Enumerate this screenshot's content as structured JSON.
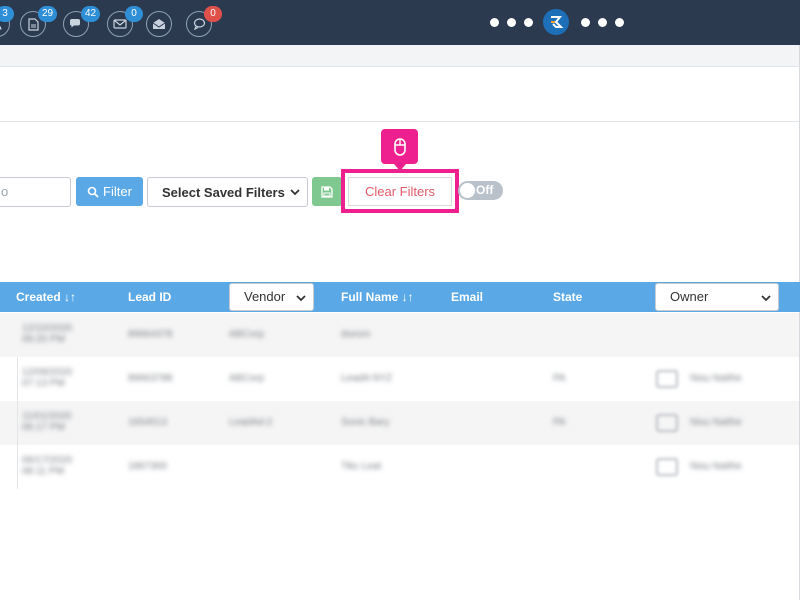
{
  "navbar": {
    "badges": [
      "3",
      "29",
      "42",
      "0",
      "0"
    ],
    "icons": [
      "user-icon",
      "document-icon",
      "comments-icon",
      "envelope-icon",
      "envelope-open-icon",
      "chat-icon"
    ],
    "colors": {
      "background": "#2b3a4f",
      "badge": "#2f8fd6",
      "badge_alert": "#e0504a"
    }
  },
  "filters": {
    "search_placeholder": "o",
    "filter_button": "Filter",
    "saved_filters": "Select Saved Filters",
    "clear_button": "Clear Filters",
    "toggle_label": "Off",
    "highlight_color": "#ee1f8e"
  },
  "table": {
    "columns": {
      "created": "Created ↓↑",
      "lead_id": "Lead ID",
      "vendor": "Vendor",
      "full_name": "Full Name ↓↑",
      "email": "Email",
      "state": "State",
      "owner": "Owner"
    },
    "header_color": "#5aa8e6",
    "rows": [
      {
        "created": "12/10/2020 09:20 PM",
        "lead_id": "89664378",
        "vendor": "ABCorp",
        "full_name": "dsesm",
        "state": "",
        "owner": ""
      },
      {
        "created": "12/09/2020 07:13 PM",
        "lead_id": "89663788",
        "vendor": "ABCorp",
        "full_name": "LeadA NYZ",
        "state": "PA",
        "owner": "Nisu Naithe"
      },
      {
        "created": "11/01/2020 06:17 PM",
        "lead_id": "1654513",
        "vendor": "LeadAd-2",
        "full_name": "Sonic Bary",
        "state": "PA",
        "owner": "Nisu Naithe"
      },
      {
        "created": "06/17/2020 08:11 PM",
        "lead_id": "1867300",
        "vendor": "",
        "full_name": "Tikc Leat",
        "state": "",
        "owner": "Nisu Naithe"
      }
    ]
  }
}
